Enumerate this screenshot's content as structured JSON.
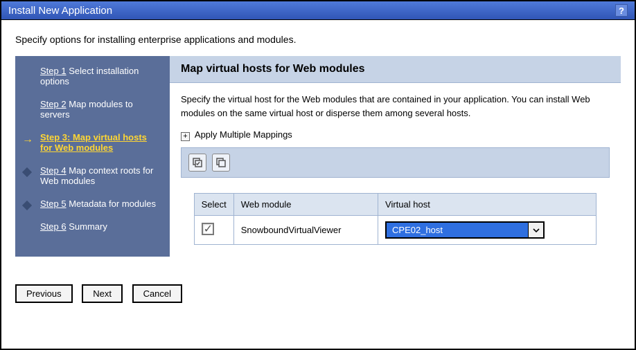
{
  "title": "Install New Application",
  "intro": "Specify options for installing enterprise applications and modules.",
  "sidebar": {
    "steps": [
      {
        "prefix": "Step 1",
        "label": "Select installation options"
      },
      {
        "prefix": "Step 2",
        "label": "Map modules to servers"
      },
      {
        "prefix": "Step 3:",
        "label": "Map virtual hosts for Web modules"
      },
      {
        "prefix": "Step 4",
        "label": "Map context roots for Web modules"
      },
      {
        "prefix": "Step 5",
        "label": "Metadata for modules"
      },
      {
        "prefix": "Step 6",
        "label": "Summary"
      }
    ]
  },
  "main": {
    "heading": "Map virtual hosts for Web modules",
    "description": "Specify the virtual host for the Web modules that are contained in your application. You can install Web modules on the same virtual host or disperse them among several hosts.",
    "expand_label": "Apply Multiple Mappings",
    "table": {
      "headers": {
        "select": "Select",
        "module": "Web module",
        "vhost": "Virtual host"
      },
      "rows": [
        {
          "checked": true,
          "module": "SnowboundVirtualViewer",
          "virtual_host": "CPE02_host"
        }
      ]
    }
  },
  "buttons": {
    "previous": "Previous",
    "next": "Next",
    "cancel": "Cancel"
  }
}
